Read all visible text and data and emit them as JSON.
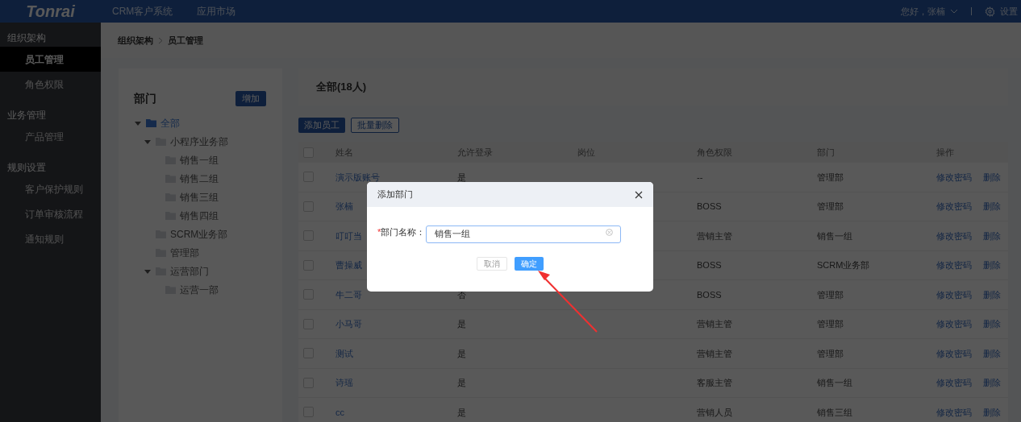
{
  "header": {
    "logo": "Tonrai",
    "nav": [
      {
        "label": "CRM客户系统",
        "selected": false
      },
      {
        "label": "应用市场",
        "selected": false
      }
    ],
    "greeting": "您好，张楠",
    "settings": "设置"
  },
  "sidebar": {
    "groups": [
      {
        "title": "组织架构",
        "items": [
          {
            "label": "员工管理",
            "selected": true
          },
          {
            "label": "角色权限",
            "selected": false
          }
        ]
      },
      {
        "title": "业务管理",
        "items": [
          {
            "label": "产品管理",
            "selected": false
          }
        ]
      },
      {
        "title": "规则设置",
        "items": [
          {
            "label": "客户保护规则",
            "selected": false
          },
          {
            "label": "订单审核流程",
            "selected": false
          },
          {
            "label": "通知规则",
            "selected": false
          }
        ]
      }
    ]
  },
  "breadcrumb": [
    "组织架构",
    "员工管理"
  ],
  "departments": {
    "title": "部门",
    "add_button": "增加",
    "tree": [
      {
        "label": "全部",
        "selected": true,
        "expanded": true,
        "children": [
          {
            "label": "小程序业务部",
            "selected": false,
            "expanded": true,
            "children": [
              {
                "label": "销售一组",
                "selected": false
              },
              {
                "label": "销售二组",
                "selected": false
              },
              {
                "label": "销售三组",
                "selected": false
              },
              {
                "label": "销售四组",
                "selected": false
              }
            ]
          },
          {
            "label": "SCRM业务部",
            "selected": false
          },
          {
            "label": "管理部",
            "selected": false
          },
          {
            "label": "运营部门",
            "selected": false,
            "expanded": true,
            "children": [
              {
                "label": "运营一部",
                "selected": false
              }
            ]
          }
        ]
      }
    ]
  },
  "employees": {
    "title": "全部(18人)",
    "buttons": [
      {
        "label": "添加员工",
        "kind": "primary"
      },
      {
        "label": "批量删除",
        "kind": "outline"
      }
    ],
    "all_checked": false,
    "columns": [
      "姓名",
      "允许登录",
      "岗位",
      "角色权限",
      "部门",
      "操作"
    ],
    "rows": [
      {
        "checked": false,
        "name": "演示版账号",
        "login": "是",
        "role": "--",
        "department": "管理部",
        "actions": [
          "修改密码",
          "删除"
        ]
      },
      {
        "checked": false,
        "name": "张楠",
        "role": "BOSS",
        "department": "管理部",
        "actions": [
          "修改密码",
          "删除"
        ]
      },
      {
        "checked": false,
        "name": "叮叮当",
        "role": "营销主管",
        "department": "销售一组",
        "actions": [
          "修改密码",
          "删除"
        ]
      },
      {
        "checked": false,
        "name": "曹操威",
        "role": "BOSS",
        "department": "SCRM业务部",
        "actions": [
          "修改密码",
          "删除"
        ]
      },
      {
        "checked": false,
        "name": "牛二哥",
        "login": "否",
        "role": "BOSS",
        "department": "管理部",
        "actions": [
          "修改密码",
          "删除"
        ]
      },
      {
        "checked": false,
        "name": "小马哥",
        "login": "是",
        "role": "营销主管",
        "department": "管理部",
        "actions": [
          "修改密码",
          "删除"
        ]
      },
      {
        "checked": false,
        "name": "测试",
        "login": "是",
        "role": "营销主管",
        "department": "管理部",
        "actions": [
          "修改密码",
          "删除"
        ]
      },
      {
        "checked": false,
        "name": "诗瑶",
        "login": "是",
        "role": "客服主管",
        "department": "销售一组",
        "actions": [
          "修改密码",
          "删除"
        ]
      },
      {
        "checked": false,
        "name": "cc",
        "login": "是",
        "role": "营销人员",
        "department": "销售三组",
        "actions": [
          "修改密码",
          "删除"
        ]
      }
    ]
  },
  "dialog": {
    "title": "添加部门",
    "field": {
      "label": "部门名称：",
      "required": true,
      "required_mark": "*",
      "value": "销售一组"
    },
    "buttons": [
      {
        "label": "取消",
        "kind": "default"
      },
      {
        "label": "确定",
        "kind": "primary"
      }
    ]
  }
}
